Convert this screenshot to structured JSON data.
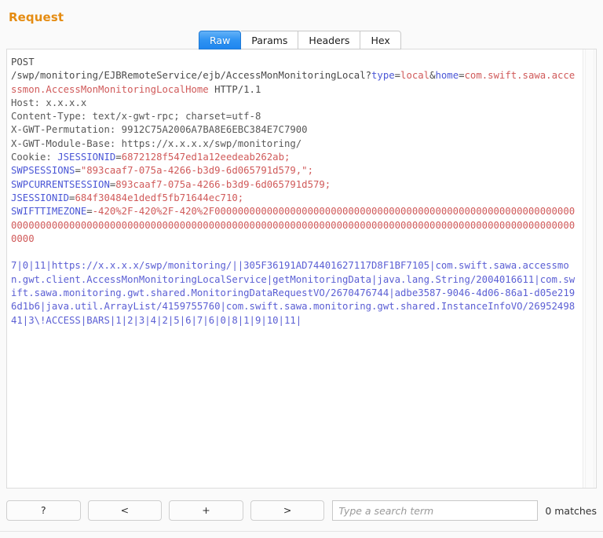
{
  "panel": {
    "title": "Request",
    "title_color": "#e58c12"
  },
  "tabs": [
    {
      "label": "Raw",
      "active": true
    },
    {
      "label": "Params",
      "active": false
    },
    {
      "label": "Headers",
      "active": false
    },
    {
      "label": "Hex",
      "active": false
    }
  ],
  "message": {
    "request_line": {
      "method": "POST",
      "path": "/swp/monitoring/EJBRemoteService/ejb/AccessMonMonitoringLocal?",
      "param1_name": "type",
      "param1_eq": "=",
      "param1_value": "local",
      "amp": "&",
      "param2_name": "home",
      "param2_eq": "=",
      "param2_value": "com.swift.sawa.accessmon.AccessMonMonitoringLocalHome",
      "version": " HTTP/1.1"
    },
    "headers": [
      {
        "name": "Host: ",
        "value": "x.x.x.x"
      },
      {
        "name": "Content-Type: ",
        "value": "text/x-gwt-rpc; charset=utf-8"
      },
      {
        "name": "X-GWT-Permutation: ",
        "value": "9912C75A2006A7BA8E6EBC384E7C7900"
      },
      {
        "name": "X-GWT-Module-Base: ",
        "value": "https://x.x.x.x/swp/monitoring/"
      }
    ],
    "cookie_label": "Cookie: ",
    "cookies": [
      {
        "name": "JSESSIONID",
        "eq": "=",
        "value": "6872128f547ed1a12eedeab262ab;"
      },
      {
        "name": "SWPSESSIONS",
        "eq": "=",
        "value": "\"893caaf7-075a-4266-b3d9-6d065791d579,\";"
      },
      {
        "name": "SWPCURRENTSESSION",
        "eq": "=",
        "value": "893caaf7-075a-4266-b3d9-6d065791d579;"
      },
      {
        "name": "JSESSIONID",
        "eq": "=",
        "value": "684f30484e1dedf5fb71644ec710;"
      },
      {
        "name": "SWIFTTIMEZONE",
        "eq": "=",
        "value": "-420%2F-420%2F-420%2F0000000000000000000000000000000000000000000000000000000000000000000000000000000000000000000000000000000000000000000000000000000000000000000000000000000000000000000"
      }
    ],
    "body": "7|0|11|https://x.x.x.x/swp/monitoring/||305F36191AD74401627117D8F1BF7105|com.swift.sawa.accessmon.gwt.client.AccessMonMonitoringLocalService|getMonitoringData|java.lang.String/2004016611|com.swift.sawa.monitoring.gwt.shared.MonitoringDataRequestVO/2670476744|adbe3587-9046-4d06-86a1-d05e2196d1b6|java.util.ArrayList/4159755760|com.swift.sawa.monitoring.gwt.shared.InstanceInfoVO/2695249841|3\\!ACCESS|BARS|1|2|3|4|2|5|6|7|6|0|8|1|9|10|11|"
  },
  "toolbar": {
    "help_label": "?",
    "prev_label": "<",
    "add_label": "+",
    "next_label": ">",
    "search_placeholder": "Type a search term",
    "search_value": "",
    "matches_label": "0 matches"
  }
}
